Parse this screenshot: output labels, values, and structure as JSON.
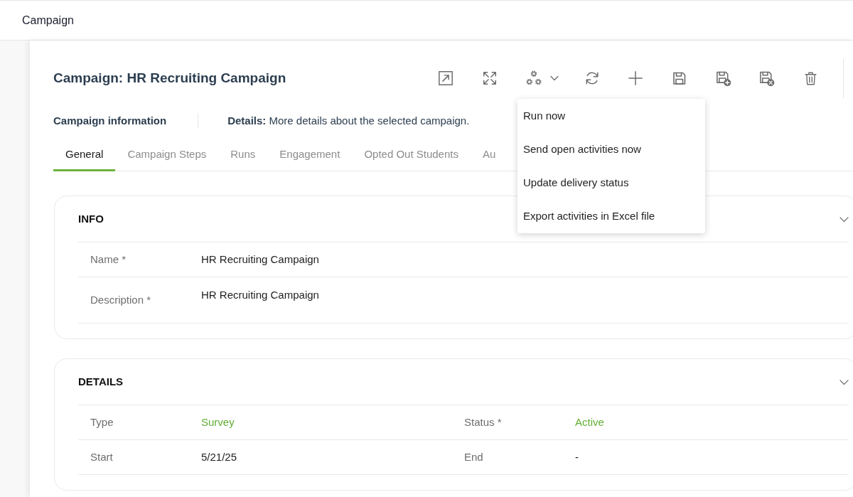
{
  "top_bar": {
    "title": "Campaign"
  },
  "record": {
    "title": "Campaign: HR Recruiting Campaign"
  },
  "actions_menu": {
    "open": true,
    "items": [
      "Run now",
      "Send open activities now",
      "Update delivery status",
      "Export activities in Excel file"
    ]
  },
  "info_bar": {
    "label": "Campaign information",
    "description": "**Details:** More details about the selected campaign."
  },
  "tabs": [
    {
      "label": "General",
      "selected": true
    },
    {
      "label": "Campaign Steps",
      "selected": false
    },
    {
      "label": "Runs",
      "selected": false
    },
    {
      "label": "Engagement",
      "selected": false
    },
    {
      "label": "Opted Out Students",
      "selected": false
    },
    {
      "label": "Au",
      "selected": false
    }
  ],
  "sections": [
    {
      "title": "INFO",
      "rows": [
        [
          {
            "label": "Name *",
            "value": "HR Recruiting Campaign",
            "kind": "plain"
          }
        ],
        [
          {
            "label": "Description *",
            "value": "HR Recruiting Campaign",
            "kind": "multiline"
          }
        ]
      ]
    },
    {
      "title": "DETAILS",
      "rows": [
        [
          {
            "label": "Type",
            "value": "Survey",
            "kind": "link"
          },
          {
            "label": "Status *",
            "value": "Active",
            "kind": "link"
          }
        ],
        [
          {
            "label": "Start",
            "value": "5/21/25",
            "kind": "plain"
          },
          {
            "label": "End",
            "value": "-",
            "kind": "plain"
          }
        ]
      ]
    }
  ]
}
